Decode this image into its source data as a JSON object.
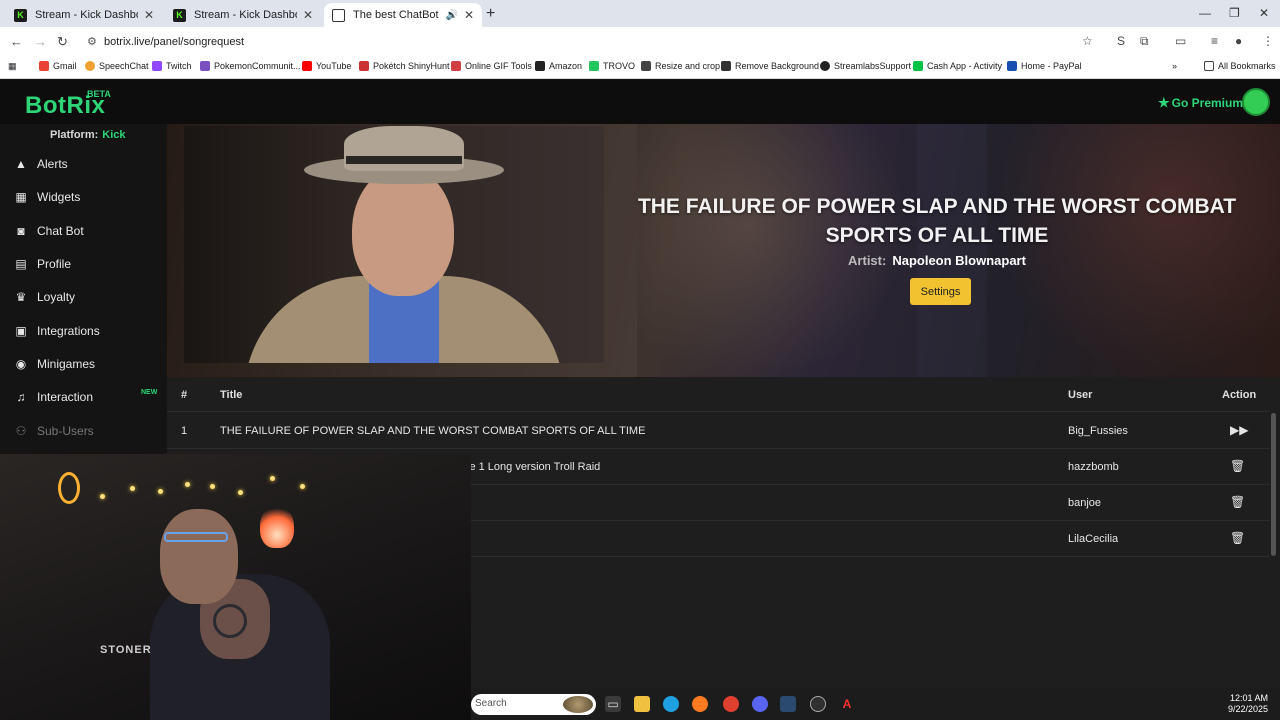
{
  "browser": {
    "tabs": [
      {
        "title": "Stream - Kick Dashboard",
        "favicon": "kick-icon"
      },
      {
        "title": "Stream - Kick Dashboard",
        "favicon": "kick-icon"
      },
      {
        "title": "The best ChatBot and Widg",
        "favicon": "botrix-icon"
      }
    ],
    "url": "botrix.live/panel/songrequest",
    "bookmarks": [
      {
        "label": "Gmail",
        "color": "#ea4335"
      },
      {
        "label": "SpeechChat",
        "color": "#f0a030"
      },
      {
        "label": "Twitch",
        "color": "#9146ff"
      },
      {
        "label": "PokemonCommunit...",
        "color": "#7a4fc0"
      },
      {
        "label": "YouTube",
        "color": "#ff0000"
      },
      {
        "label": "Pokétch ShinyHunt",
        "color": "#cc3333"
      },
      {
        "label": "Online GIF Tools",
        "color": "#d04040"
      },
      {
        "label": "Amazon",
        "color": "#222222"
      },
      {
        "label": "TROVO",
        "color": "#22c55e"
      },
      {
        "label": "Resize and crop",
        "color": "#444444"
      },
      {
        "label": "Remove Background",
        "color": "#333333"
      },
      {
        "label": "StreamlabsSupport",
        "color": "#222222"
      },
      {
        "label": "Cash App - Activity",
        "color": "#00c244"
      },
      {
        "label": "Home - PayPal",
        "color": "#1a4fb0"
      }
    ],
    "all_bookmarks": "All Bookmarks"
  },
  "app": {
    "logo": "BotRix",
    "beta": "BETA",
    "go_premium": "Go Premium",
    "platform_label": "Platform:",
    "platform_value": "Kick",
    "nav": [
      {
        "label": "Alerts",
        "icon": "warning-icon"
      },
      {
        "label": "Widgets",
        "icon": "grid-icon"
      },
      {
        "label": "Chat Bot",
        "icon": "robot-icon"
      },
      {
        "label": "Profile",
        "icon": "id-card-icon"
      },
      {
        "label": "Loyalty",
        "icon": "trophy-icon"
      },
      {
        "label": "Integrations",
        "icon": "puzzle-icon"
      },
      {
        "label": "Minigames",
        "icon": "gamepad-icon"
      },
      {
        "label": "Interaction",
        "icon": "music-icon"
      },
      {
        "label": "Sub-Users",
        "icon": "users-icon"
      }
    ],
    "new_badge": "NEW"
  },
  "now_playing": {
    "title": "THE FAILURE OF POWER SLAP AND THE WORST COMBAT SPORTS OF ALL TIME",
    "artist_label": "Artist:",
    "artist": "Napoleon Blownapart",
    "settings": "Settings"
  },
  "queue": {
    "headers": {
      "num": "#",
      "title": "Title",
      "user": "User",
      "action": "Action"
    },
    "rows": [
      {
        "num": "1",
        "title": "THE FAILURE OF POWER SLAP AND THE WORST COMBAT SPORTS OF ALL TIME",
        "user": "Big_Fussies",
        "action": "skip-icon"
      },
      {
        "num": "",
        "title": "le 1 Long version Troll Raid",
        "user": "hazzbomb",
        "action": "trash-icon"
      },
      {
        "num": "",
        "title": "",
        "user": "banjoe",
        "action": "trash-icon"
      },
      {
        "num": "",
        "title": "",
        "user": "LilaCecilia",
        "action": "trash-icon"
      }
    ]
  },
  "webcam": {
    "sign": "STONER"
  },
  "taskbar": {
    "search_placeholder": "Search",
    "time": "12:01 AM",
    "date": "9/22/2025"
  },
  "colors": {
    "accent": "#2ed577",
    "settings_button": "#f2c230"
  }
}
